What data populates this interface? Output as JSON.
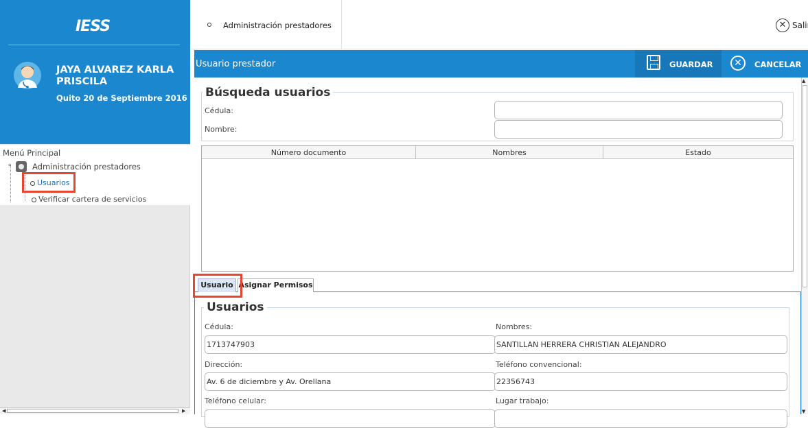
{
  "sidebar": {
    "logo_text": "IESS",
    "user_name": "JAYA ALVAREZ KARLA PRISCILA",
    "date": "Quito 20 de Septiembre 2016",
    "menu_title": "Menú Principal",
    "tree": {
      "parent": "Administración prestadores",
      "items": [
        "Usuarios",
        "Verificar cartera de servicios"
      ]
    }
  },
  "topbar": {
    "tab_label": "Administración prestadores",
    "exit_label": "Salir"
  },
  "form": {
    "title": "Usuario prestador",
    "save_label": "GUARDAR",
    "cancel_label": "CANCELAR"
  },
  "search": {
    "legend": "Búsqueda usuarios",
    "cedula_label": "Cédula:",
    "nombre_label": "Nombre:",
    "cedula_value": "",
    "nombre_value": "",
    "columns": [
      "Número documento",
      "Nombres",
      "Estado"
    ]
  },
  "tabs": [
    "Usuario",
    "Asignar Permisos"
  ],
  "usuarios": {
    "legend": "Usuarios",
    "cedula_label": "Cédula:",
    "cedula_value": "1713747903",
    "nombres_label": "Nombres:",
    "nombres_value": "SANTILLAN HERRERA CHRISTIAN ALEJANDRO",
    "direccion_label": "Dirección:",
    "direccion_value": "Av. 6 de diciembre y Av. Orellana",
    "telefono_label": "Teléfono convencional:",
    "telefono_value": "22356743",
    "celular_label": "Teléfono celular:",
    "celular_value": "",
    "lugar_label": "Lugar trabajo:",
    "lugar_value": ""
  },
  "colors": {
    "brand_blue": "#1a87cf",
    "highlight_red": "#e8442e"
  }
}
